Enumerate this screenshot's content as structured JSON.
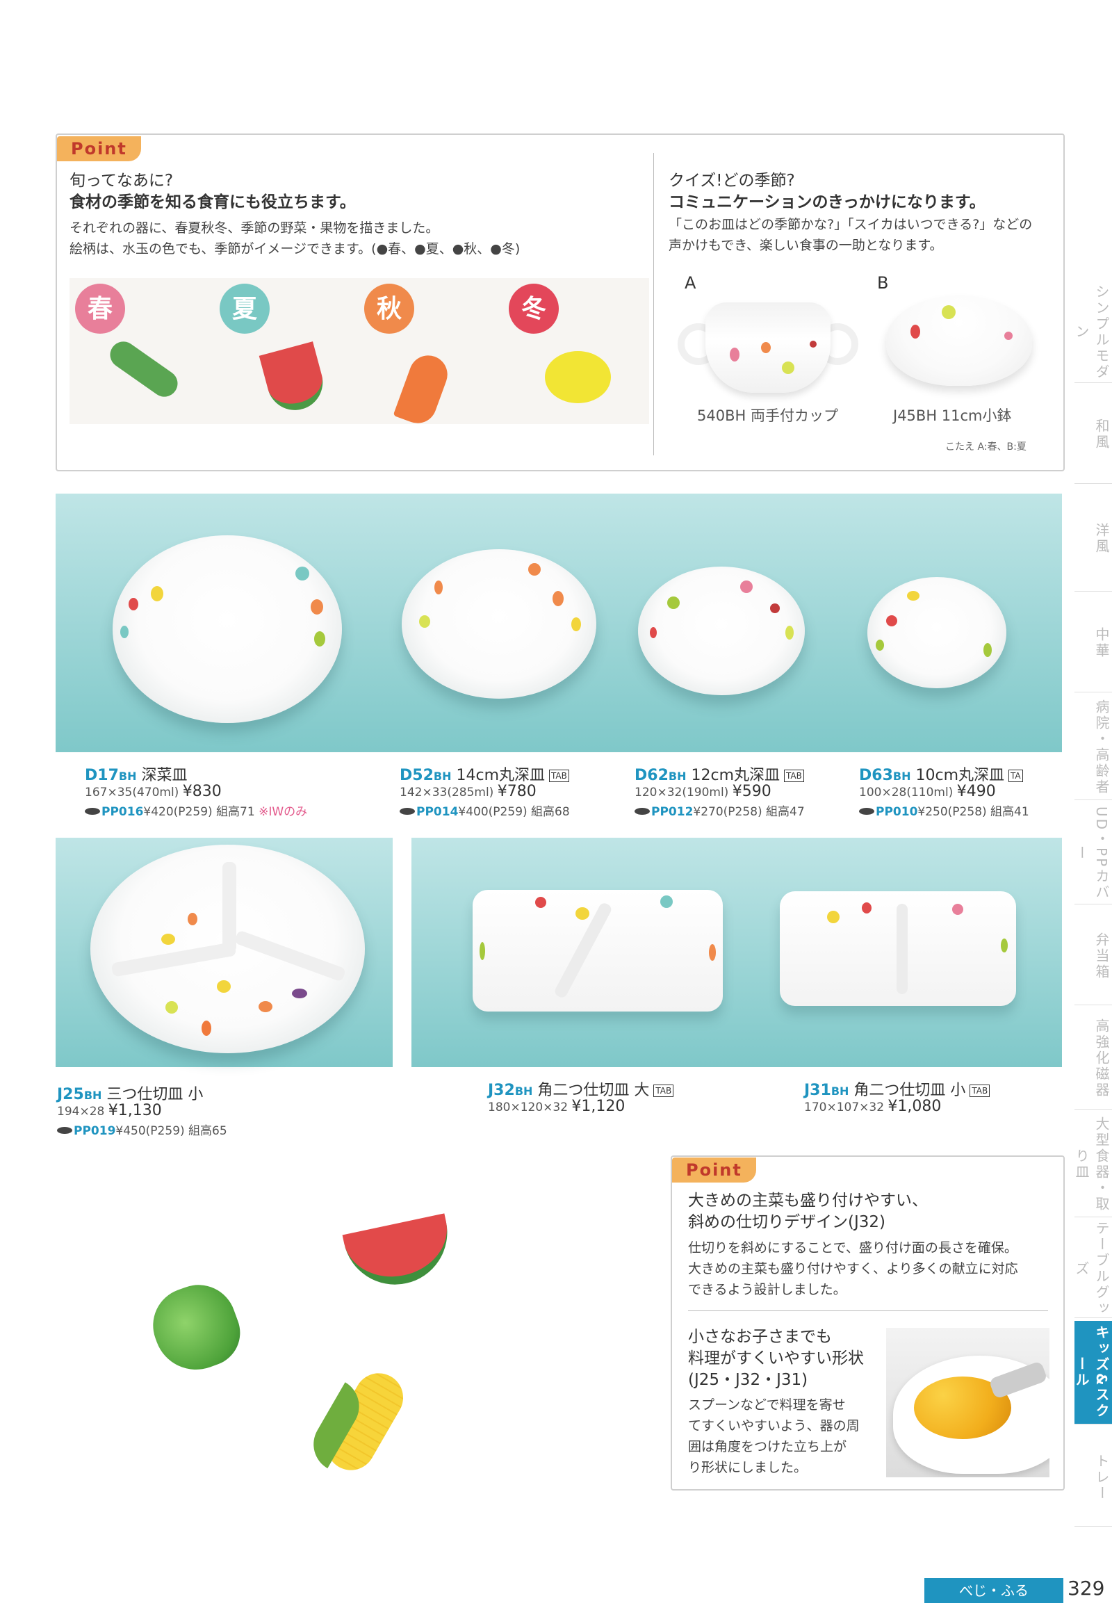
{
  "point1": {
    "tag": "Point",
    "left_heading": [
      "旬ってなあに?",
      "食材の季節を知る食育にも役立ちます。"
    ],
    "left_body": [
      "それぞれの器に、春夏秋冬、季節の野菜・果物を描きました。",
      "絵柄は、水玉の色でも、季節がイメージできます。(●春、●夏、●秋、●冬)"
    ],
    "seasons": [
      {
        "label": "春",
        "color": "#e87f9a"
      },
      {
        "label": "夏",
        "color": "#79c8c3"
      },
      {
        "label": "秋",
        "color": "#f08a4b"
      },
      {
        "label": "冬",
        "color": "#e3475a"
      }
    ],
    "right_heading": [
      "クイズ!どの季節?",
      "コミュニケーションのきっかけになります。"
    ],
    "right_body": [
      "「このお皿はどの季節かな?」「スイカはいつできる?」などの",
      "声かけもでき、楽しい食事の一助となります。"
    ],
    "quiz": [
      {
        "letter": "A",
        "caption": "540BH 両手付カップ"
      },
      {
        "letter": "B",
        "caption": "J45BH 11cm小鉢"
      }
    ],
    "answer": "こたえ A:春、B:夏"
  },
  "products_row1": [
    {
      "code": "D17",
      "suffix": "BH",
      "name": "深菜皿",
      "mark": "",
      "size": "167×35(470ml)",
      "price": "¥830",
      "pp": "PP016",
      "pp_price": "¥420",
      "page": "(P259)",
      "stack": "組高71",
      "note": "※IWのみ"
    },
    {
      "code": "D52",
      "suffix": "BH",
      "name": "14cm丸深皿",
      "mark": "TAB",
      "size": "142×33(285ml)",
      "price": "¥780",
      "pp": "PP014",
      "pp_price": "¥400",
      "page": "(P259)",
      "stack": "組高68",
      "note": ""
    },
    {
      "code": "D62",
      "suffix": "BH",
      "name": "12cm丸深皿",
      "mark": "TAB",
      "size": "120×32(190ml)",
      "price": "¥590",
      "pp": "PP012",
      "pp_price": "¥270",
      "page": "(P258)",
      "stack": "組高47",
      "note": ""
    },
    {
      "code": "D63",
      "suffix": "BH",
      "name": "10cm丸深皿",
      "mark": "TA",
      "size": "100×28(110ml)",
      "price": "¥490",
      "pp": "PP010",
      "pp_price": "¥250",
      "page": "(P258)",
      "stack": "組高41",
      "note": ""
    }
  ],
  "products_row2": [
    {
      "code": "J25",
      "suffix": "BH",
      "name": "三つ仕切皿 小",
      "mark": "",
      "size": "194×28",
      "price": "¥1,130",
      "pp": "PP019",
      "pp_price": "¥450",
      "page": "(P259)",
      "stack": "組高65"
    },
    {
      "code": "J32",
      "suffix": "BH",
      "name": "角二つ仕切皿 大",
      "mark": "TAB",
      "size": "180×120×32",
      "price": "¥1,120"
    },
    {
      "code": "J31",
      "suffix": "BH",
      "name": "角二つ仕切皿 小",
      "mark": "TAB",
      "size": "170×107×32",
      "price": "¥1,080"
    }
  ],
  "point2": {
    "tag": "Point",
    "heading": [
      "大きめの主菜も盛り付けやすい、",
      "斜めの仕切りデザイン(J32)"
    ],
    "body": [
      "仕切りを斜めにすることで、盛り付け面の長さを確保。",
      "大きめの主菜も盛り付けやすく、より多くの献立に対応",
      "できるよう設計しました。"
    ],
    "heading2": [
      "小さなお子さまでも",
      "料理がすくいやすい形状",
      "(J25・J32・J31)"
    ],
    "body2": [
      "スプーンなどで料理を寄せ",
      "てすくいやすいよう、器の周",
      "囲は角度をつけた立ち上が",
      "り形状にしました。"
    ]
  },
  "side_tabs": [
    "シンプルモダン",
    "和風",
    "洋風",
    "中華",
    "病院・高齢者",
    "UD・PPカバー",
    "弁当箱",
    "高強化磁器",
    "大型食器・取り皿",
    "テーブルグッズ",
    "キッズ&スクール",
    "トレー"
  ],
  "footer": {
    "series": "べじ・ふる",
    "page": "329"
  },
  "colors": {
    "accent": "#1f94c0",
    "point_tag": "#f4b25c"
  }
}
